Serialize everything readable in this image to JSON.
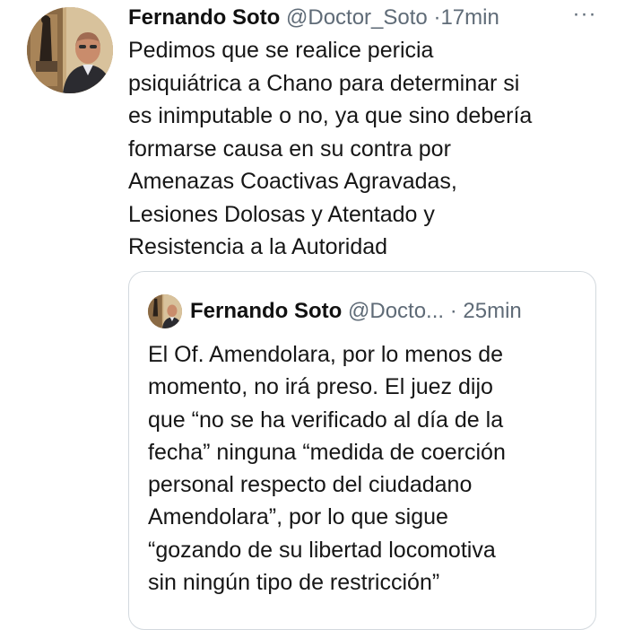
{
  "tweet": {
    "author_name": "Fernando Soto",
    "author_handle": "@Doctor_Soto",
    "separator": "·",
    "timestamp": "17min",
    "more_label": "···",
    "text_lines": [
      "Pedimos que se realice pericia",
      "psiquiátrica a Chano para determinar si",
      "es inimputable o no, ya que sino debería",
      "formarse causa en su contra por",
      "Amenazas Coactivas Agravadas,",
      "Lesiones Dolosas y Atentado y",
      "Resistencia a la Autoridad"
    ]
  },
  "quoted_tweet": {
    "author_name": "Fernando Soto",
    "author_handle": "@Docto...",
    "separator": "·",
    "timestamp": "25min",
    "text_lines": [
      "El Of. Amendolara, por lo menos de",
      "momento, no irá preso. El juez dijo",
      "que “no se ha verificado al día de la",
      "fecha” ninguna “medida de coerción",
      "personal respecto del ciudadano",
      "Amendolara”,  por lo que sigue",
      "“gozando de su libertad locomotiva",
      "sin ningún tipo de restricción”"
    ]
  },
  "icons": {
    "avatar": "avatar-photo",
    "more": "more-options-icon"
  },
  "colors": {
    "text": "#111111",
    "secondary": "#5f6b77",
    "border": "#d3d9de"
  }
}
